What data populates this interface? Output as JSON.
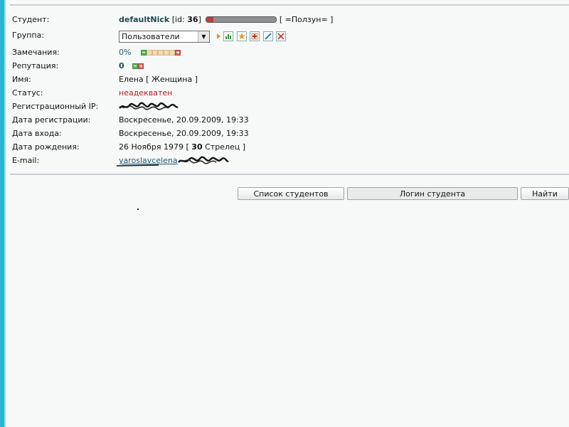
{
  "student": {
    "label": "Студент:",
    "nick": "defaultNick",
    "id_prefix": "[id: ",
    "id_value": "36",
    "id_suffix": "]",
    "progress": 0.1,
    "slider_text": "[ =Ползун= ]"
  },
  "group": {
    "label": "Группа:",
    "selected": "Пользователи",
    "tools": [
      "chart-icon",
      "star-icon",
      "add-icon",
      "edit-icon",
      "delete-icon"
    ]
  },
  "remarks": {
    "label": "Замечания:",
    "value": "0%",
    "level": 0
  },
  "reputation": {
    "label": "Репутация:",
    "value": "0"
  },
  "name": {
    "label": "Имя:",
    "value": "Елена [ Женщина ]"
  },
  "status": {
    "label": "Статус:",
    "value": "неадекватен"
  },
  "reg_ip": {
    "label": "Регистрационный IP:"
  },
  "reg_date": {
    "label": "Дата регистрации:",
    "value": "Воскресенье, 20.09.2009, 19:33"
  },
  "login_date": {
    "label": "Дата входа:",
    "value": "Воскресенье, 20.09.2009, 19:33"
  },
  "birth": {
    "label": "Дата рождения:",
    "date": "26 Ноября 1979",
    "open": " [ ",
    "age": "30",
    "sign": " Стрелец ]"
  },
  "email": {
    "label": "E-mail:",
    "value": "yaroslavcelena"
  },
  "buttons": {
    "students_list": "Список студентов",
    "student_login": "Логин студента",
    "find": "Найти"
  },
  "colors": {
    "accent": "#29b8cf",
    "nick": "#1d4a52",
    "status": "#b22222",
    "link": "#1e5a70"
  }
}
